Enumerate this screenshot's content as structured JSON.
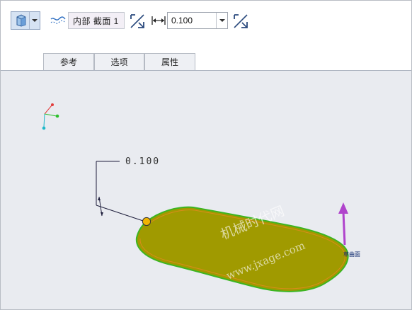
{
  "toolbar": {
    "solid_button_icon": "solid-block-icon",
    "section_icon": "section-wave-icon",
    "section_value": "内部 截面 1",
    "flip_icon": "flip-direction-icon",
    "thickness_icon": "dimension-width-icon",
    "thickness_value": "0.100",
    "dropdown_icon": "chevron-down-icon"
  },
  "tabs": [
    {
      "label": "参考"
    },
    {
      "label": "选项"
    },
    {
      "label": "属性"
    }
  ],
  "viewport": {
    "dimension_text": "0.100",
    "surface_label": "草曲面",
    "watermark_line1": "机械时代网",
    "watermark_line2": "www.jxage.com",
    "colors": {
      "background": "#e9ebf0",
      "surface_fill": "#a09a00",
      "surface_edge": "#3cb521",
      "direction_arrow": "#b044cc",
      "handle": "#f0b400"
    }
  }
}
